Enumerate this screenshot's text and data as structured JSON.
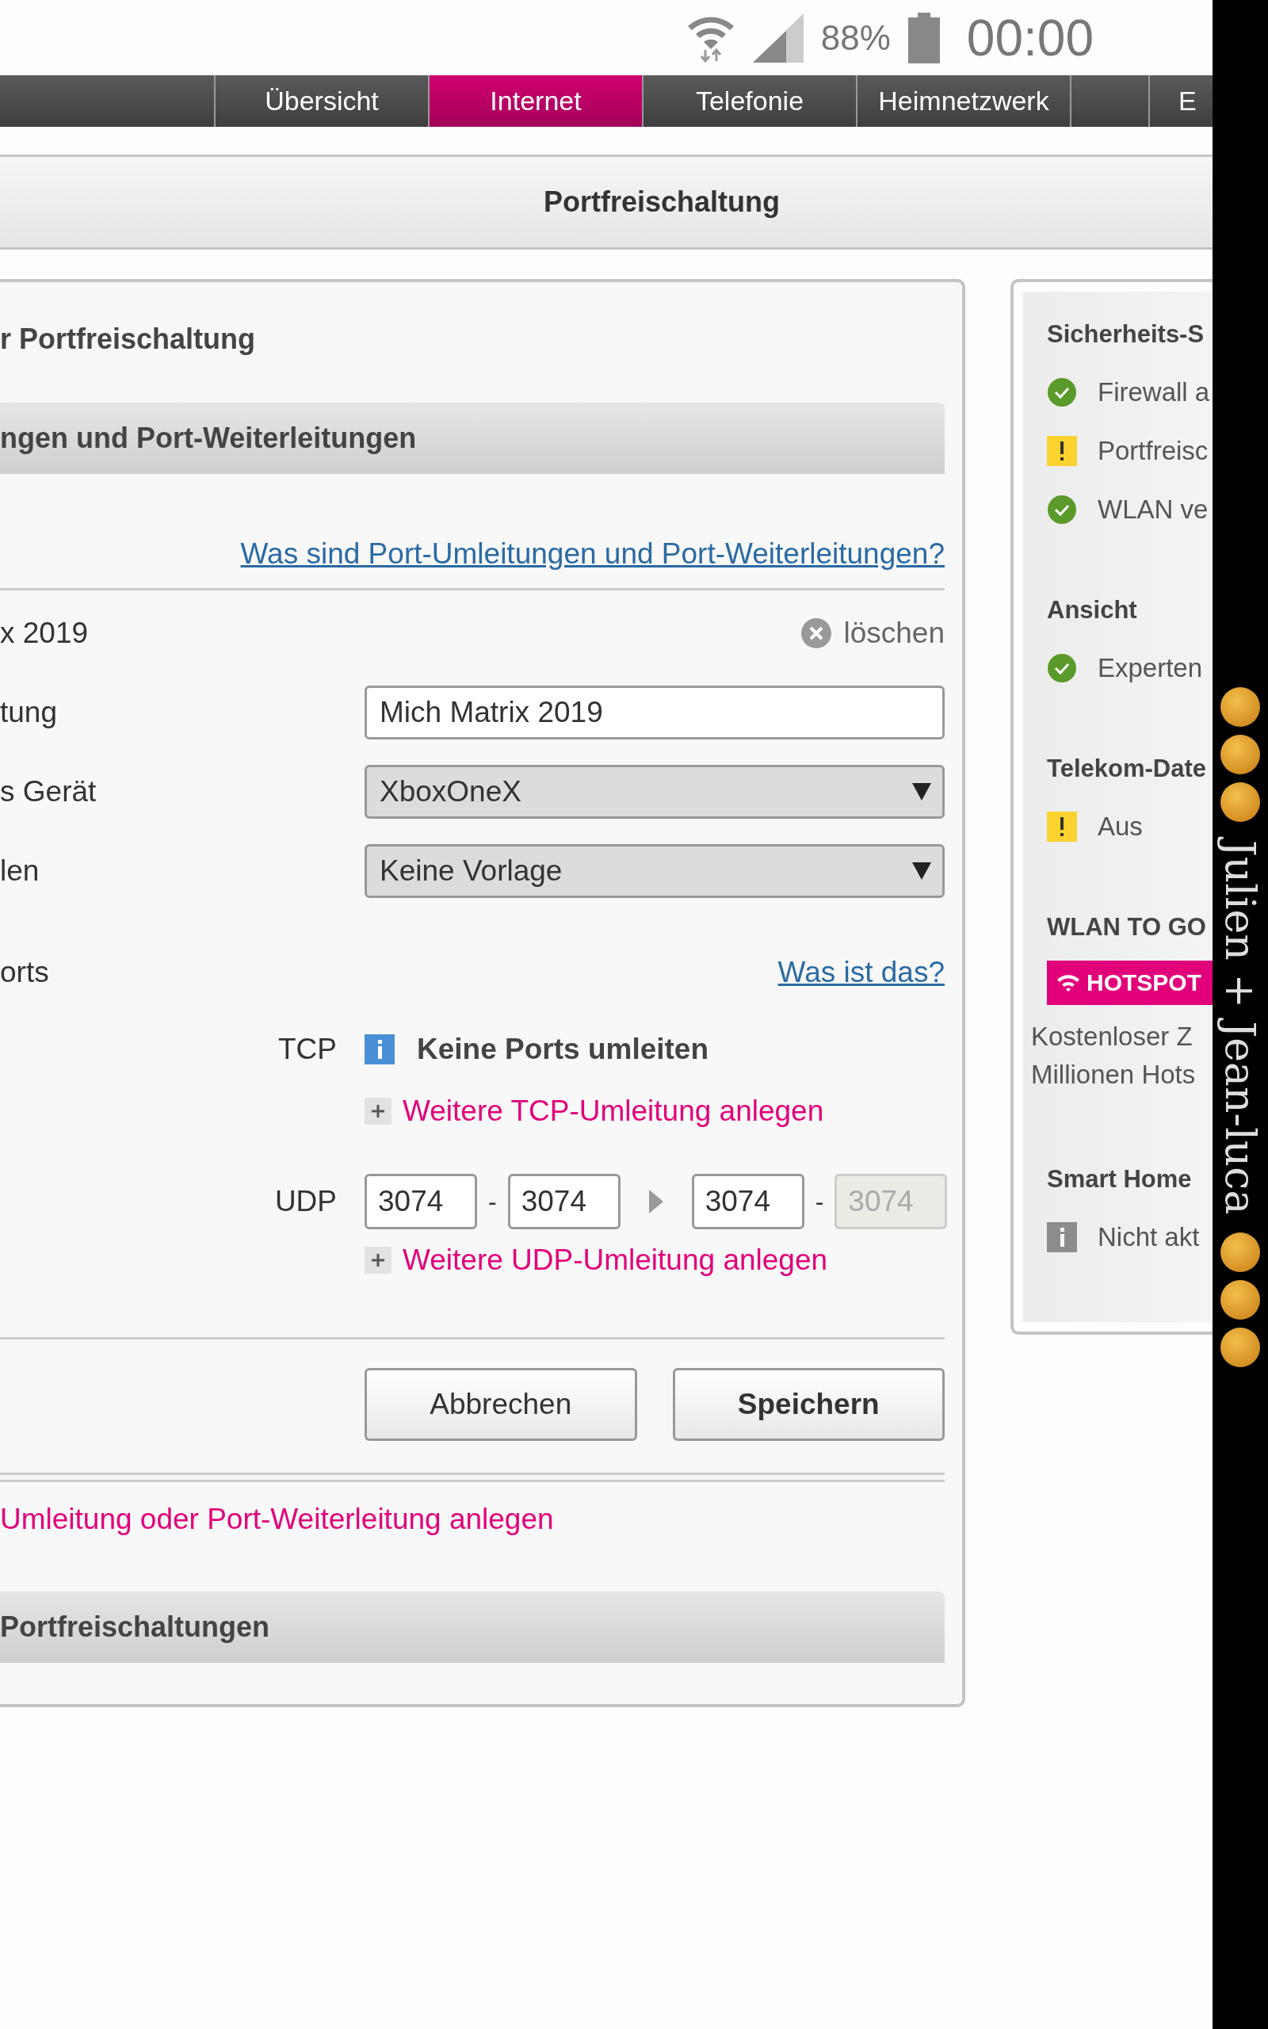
{
  "status_bar": {
    "battery": "88%",
    "time": "00:00"
  },
  "nav_tabs": [
    {
      "label": "Übersicht",
      "selected": false
    },
    {
      "label": "Internet",
      "selected": true
    },
    {
      "label": "Telefonie",
      "selected": false
    },
    {
      "label": "Heimnetzwerk",
      "selected": false
    }
  ],
  "nav_cut_tab": "E",
  "page_title": "Portfreischaltung",
  "main": {
    "title": "r Portfreischaltung",
    "section_header": "ngen und Port-Weiterleitungen",
    "help_link": "Was sind Port-Umleitungen und Port-Weiterleitungen?",
    "entry_name": "x 2019",
    "delete": "löschen",
    "fields": [
      {
        "label": "tung",
        "kind": "input",
        "value": "Mich Matrix 2019"
      },
      {
        "label": "s Gerät",
        "kind": "select",
        "value": "XboxOneX"
      },
      {
        "label": "len",
        "kind": "select",
        "value": "Keine Vorlage"
      }
    ],
    "ports_label": "orts",
    "ports_help": "Was ist das?",
    "tcp": {
      "label": "TCP",
      "info": "Keine Ports umleiten",
      "add": "Weitere TCP-Umleitung anlegen"
    },
    "udp": {
      "label": "UDP",
      "ports": [
        {
          "value": "3074",
          "disabled": false
        },
        {
          "value": "3074",
          "disabled": false
        },
        {
          "value": "3074",
          "disabled": false
        },
        {
          "value": "3074",
          "disabled": true
        }
      ],
      "separator": "-",
      "add": "Weitere UDP-Umleitung anlegen"
    },
    "buttons": [
      {
        "label": "Abbrechen",
        "primary": false
      },
      {
        "label": "Speichern",
        "primary": true
      }
    ],
    "new_link": "Umleitung oder Port-Weiterleitung anlegen",
    "list_header": "Portfreischaltungen"
  },
  "side": {
    "sections": [
      {
        "title": "Sicherheits-S",
        "items": [
          {
            "kind": "ok",
            "text": "Firewall a"
          },
          {
            "kind": "warn",
            "text": "Portfreisc"
          },
          {
            "kind": "ok",
            "text": "WLAN ve"
          }
        ]
      },
      {
        "title": "Ansicht",
        "items": [
          {
            "kind": "ok",
            "text": "Experten"
          }
        ]
      },
      {
        "title": "Telekom-Date",
        "items": [
          {
            "kind": "warn",
            "text": "Aus"
          }
        ]
      },
      {
        "title": "WLAN TO GO",
        "badge": "HOTSPOT",
        "lines": [
          "Kostenloser Z",
          "Millionen Hots"
        ]
      },
      {
        "title": "Smart Home",
        "items": [
          {
            "kind": "info",
            "text": "Nicht akt"
          }
        ]
      }
    ]
  },
  "edge_note": "Julien + Jean-luca"
}
